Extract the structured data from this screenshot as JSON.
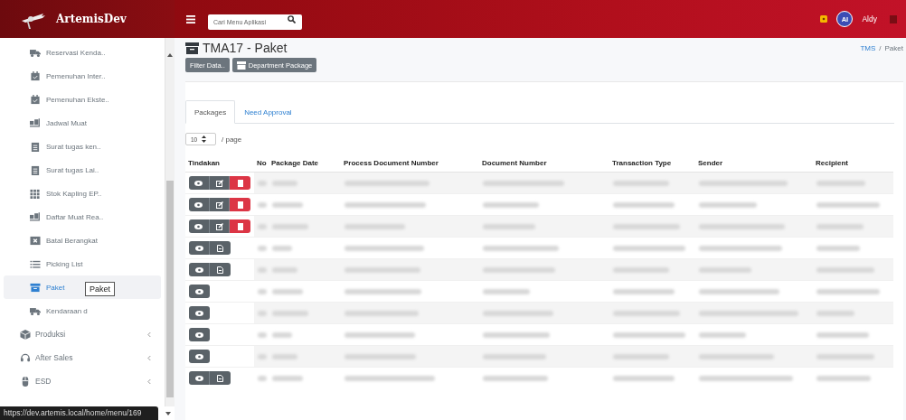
{
  "app": {
    "name": "ArtemisDev"
  },
  "sidebar": {
    "items": [
      {
        "label": "Reservasi Kenda..",
        "selected": false
      },
      {
        "label": "Pemenuhan Inter..",
        "selected": false
      },
      {
        "label": "Pemenuhan Ekste..",
        "selected": false
      },
      {
        "label": "Jadwal Muat",
        "selected": false
      },
      {
        "label": "Surat tugas ken..",
        "selected": false
      },
      {
        "label": "Surat tugas Lai..",
        "selected": false
      },
      {
        "label": "Stok Kapling EP..",
        "selected": false
      },
      {
        "label": "Daftar Muat Rea..",
        "selected": false
      },
      {
        "label": "Batal Berangkat",
        "selected": false
      },
      {
        "label": "Picking List",
        "selected": false
      },
      {
        "label": "Paket",
        "selected": true
      },
      {
        "label": "Kendaraan d",
        "selected": false
      }
    ],
    "groups": [
      {
        "label": "Produksi",
        "expanded": false
      },
      {
        "label": "After Sales",
        "expanded": false
      },
      {
        "label": "ESD",
        "expanded": false
      }
    ],
    "tooltip": "Paket",
    "status_url": "https://dev.artemis.local/home/menu/169"
  },
  "header": {
    "search": {
      "placeholder": "Cari Menu Aplikasi"
    },
    "avatar": "AI",
    "user": "Aldy"
  },
  "page": {
    "title": "TMA17 - Paket",
    "breadcrumb": {
      "items": [
        "TMS",
        "Paket"
      ],
      "separator": "/"
    },
    "buttons": [
      "Filter Data..",
      "Department Package"
    ]
  },
  "tabs": [
    {
      "label": "Packages",
      "selected": true
    },
    {
      "label": "Need Approval",
      "selected": false
    }
  ],
  "page_size": {
    "value": "10",
    "suffix": "/ page"
  },
  "table": {
    "columns": [
      "Tindakan",
      "No",
      "Package Date",
      "Process Document Number",
      "Document Number",
      "Transaction Type",
      "Sender",
      "Recipient"
    ],
    "rows": [
      {
        "actions": [
          {
            "kind": "view"
          },
          {
            "kind": "edit"
          },
          {
            "kind": "delete"
          }
        ]
      },
      {
        "actions": [
          {
            "kind": "view"
          },
          {
            "kind": "edit"
          },
          {
            "kind": "delete"
          }
        ]
      },
      {
        "actions": [
          {
            "kind": "view"
          },
          {
            "kind": "edit"
          },
          {
            "kind": "delete"
          }
        ]
      },
      {
        "actions": [
          {
            "kind": "view"
          },
          {
            "kind": "document"
          }
        ]
      },
      {
        "actions": [
          {
            "kind": "view"
          },
          {
            "kind": "document"
          }
        ]
      },
      {
        "actions": [
          {
            "kind": "view"
          }
        ]
      },
      {
        "actions": [
          {
            "kind": "view"
          }
        ]
      },
      {
        "actions": [
          {
            "kind": "view"
          }
        ]
      },
      {
        "actions": [
          {
            "kind": "view"
          }
        ]
      },
      {
        "actions": [
          {
            "kind": "view"
          },
          {
            "kind": "document"
          }
        ]
      }
    ]
  }
}
